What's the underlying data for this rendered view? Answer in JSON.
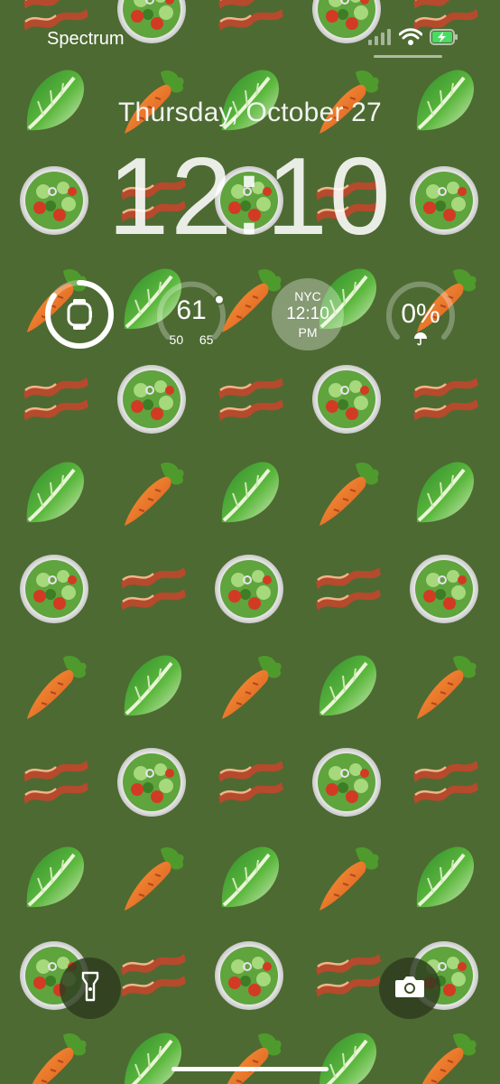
{
  "status_bar": {
    "carrier": "Spectrum",
    "signal_icon": "cellular-signal-icon",
    "wifi_icon": "wifi-icon",
    "battery_icon": "battery-charging-icon",
    "battery_color": "#4cd964"
  },
  "lock_screen": {
    "date": "Thursday, October 27",
    "time": "12:10"
  },
  "widgets": {
    "watch": {
      "icon": "apple-watch-icon",
      "battery_level": 0.85
    },
    "weather": {
      "temperature": "61",
      "low": "50",
      "high": "65",
      "range_level": 0.73
    },
    "world_clock": {
      "city": "NYC",
      "time": "12:10",
      "period": "PM"
    },
    "precipitation": {
      "value": "0%",
      "icon": "umbrella-icon",
      "level": 0.0
    }
  },
  "quick_actions": {
    "flashlight": {
      "icon": "flashlight-icon"
    },
    "camera": {
      "icon": "camera-icon"
    }
  },
  "wallpaper": {
    "background_color": "#4d6a32",
    "emoji_pattern": [
      "bacon",
      "salad",
      "lettuce",
      "carrot"
    ]
  }
}
